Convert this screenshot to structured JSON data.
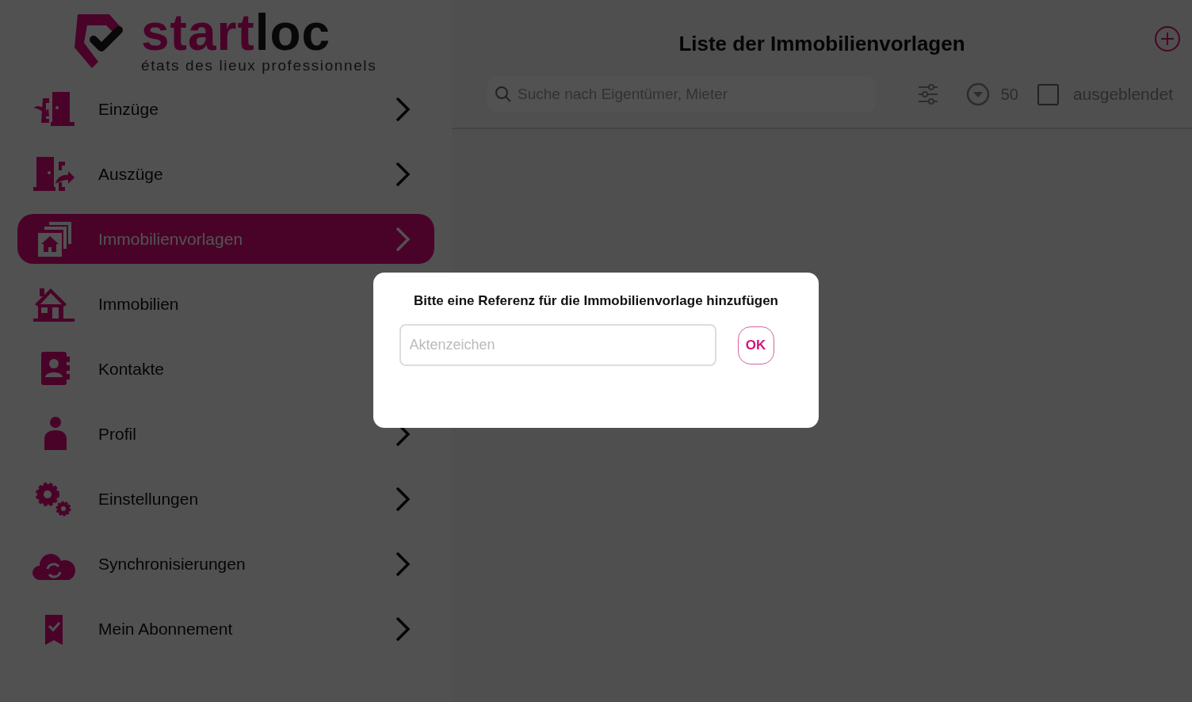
{
  "logo": {
    "brand_primary": "start",
    "brand_secondary": "loc",
    "tagline": "états des lieux professionnels"
  },
  "menu": [
    {
      "label": "Einzüge",
      "selected": false
    },
    {
      "label": "Auszüge",
      "selected": false
    },
    {
      "label": "Immobilienvorlagen",
      "selected": true
    },
    {
      "label": "Immobilien",
      "selected": false
    },
    {
      "label": "Kontakte",
      "selected": false
    },
    {
      "label": "Profil",
      "selected": false
    },
    {
      "label": "Einstellungen",
      "selected": false
    },
    {
      "label": "Synchronisierungen",
      "selected": false
    },
    {
      "label": "Mein Abonnement",
      "selected": false
    }
  ],
  "header": {
    "title": "Liste der Immobilienvorlagen"
  },
  "toolbar": {
    "search": {
      "placeholder": "Suche nach Eigentümer, Mieter"
    },
    "page_size": "50",
    "hidden_filter": {
      "label": "ausgeblendet",
      "checked": false
    }
  },
  "dialog": {
    "message": "Bitte eine Referenz für die Immobilienvorlage hinzufügen",
    "field": {
      "placeholder": "Aktenzeichen"
    },
    "ok_button": "OK"
  }
}
